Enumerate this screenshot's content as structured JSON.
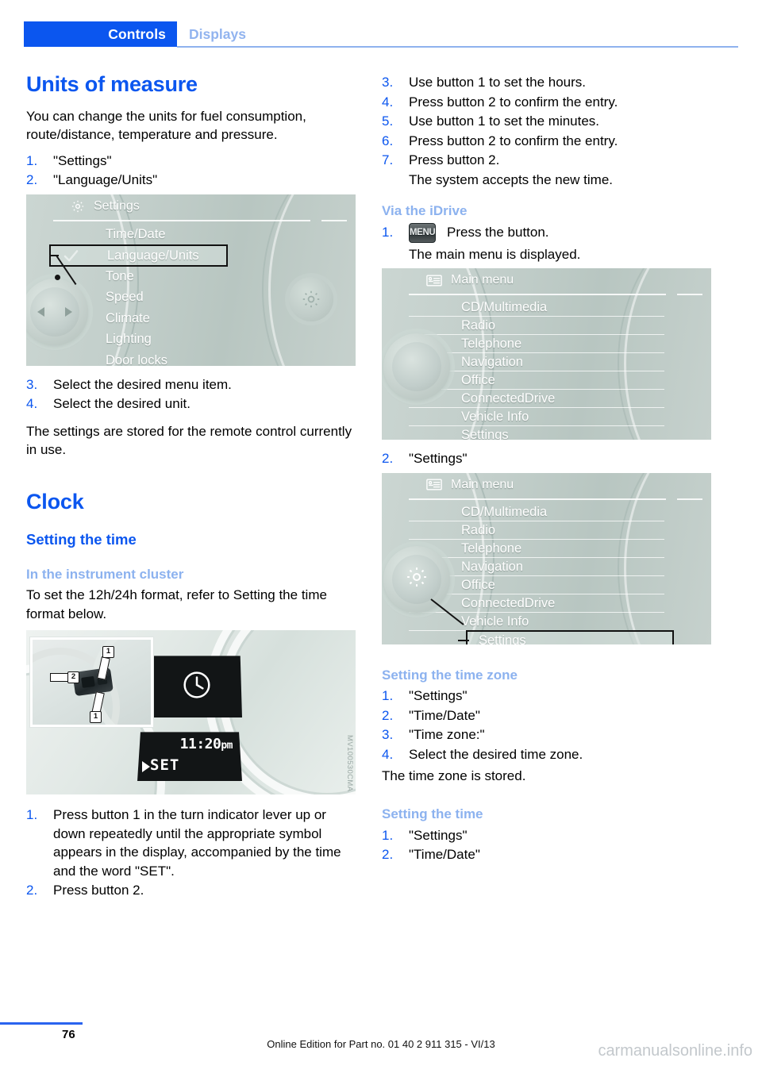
{
  "header": {
    "tab_active": "Controls",
    "tab_inactive": "Displays"
  },
  "left_column": {
    "chapter_title": "Units of measure",
    "intro": "You can change the units for fuel consumption, route/distance, temperature and pressure.",
    "steps_a": [
      {
        "num": "1.",
        "text": "\"Settings\""
      },
      {
        "num": "2.",
        "text": "\"Language/Units\""
      }
    ],
    "settings_screen": {
      "icon": "gear-icon",
      "title": "Settings",
      "items": [
        "Time/Date",
        "Language/Units",
        "Tone",
        "Speed",
        "Climate",
        "Lighting",
        "Door locks"
      ],
      "highlighted_item": "Language/Units",
      "checkmark": "✓",
      "knob_icon": "left-right-arrows-icon",
      "side_icon": "gear-icon"
    },
    "steps_b": [
      {
        "num": "3.",
        "text": "Select the desired menu item."
      },
      {
        "num": "4.",
        "text": "Select the desired unit."
      }
    ],
    "note": "The settings are stored for the remote control currently in use.",
    "clock_title": "Clock",
    "setting_time_heading": "Setting the time",
    "instrument_cluster_heading": "In the instrument cluster",
    "instrument_cluster_body": "To set the 12h/24h format, refer to Setting the time format below.",
    "cluster_image": {
      "clock_icon": "clock-icon",
      "time": "11:20",
      "ampm": "pm",
      "set_label": "SET",
      "caret": "play-caret-icon",
      "callout_1a": "1",
      "callout_1b": "1",
      "callout_2": "2",
      "watermark": "MV100530CMA"
    },
    "steps_c": [
      {
        "num": "1.",
        "text": "Press button 1 in the turn indicator lever up or down repeatedly until the appropriate symbol appears in the display, accompanied by the time and the word \"SET\"."
      },
      {
        "num": "2.",
        "text": "Press button 2."
      }
    ]
  },
  "right_column": {
    "steps_d": [
      {
        "num": "3.",
        "text": "Use button 1 to set the hours."
      },
      {
        "num": "4.",
        "text": "Press button 2 to confirm the entry."
      },
      {
        "num": "5.",
        "text": "Use button 1 to set the minutes."
      },
      {
        "num": "6.",
        "text": "Press button 2 to confirm the entry."
      },
      {
        "num": "7.",
        "text": "Press button 2."
      }
    ],
    "steps_d_note": "The system accepts the new time.",
    "via_idrive_heading": "Via the iDrive",
    "menu_step": {
      "num": "1.",
      "button_label": "MENU",
      "text": "Press the button."
    },
    "menu_step_note": "The main menu is displayed.",
    "main_menu_screen": {
      "icon": "list-menu-icon",
      "title": "Main menu",
      "items": [
        "CD/Multimedia",
        "Radio",
        "Telephone",
        "Navigation",
        "Office",
        "ConnectedDrive",
        "Vehicle Info",
        "Settings"
      ],
      "knob_icon": "plain-knob-icon"
    },
    "step_settings": {
      "num": "2.",
      "text": "\"Settings\""
    },
    "main_menu_screen_2": {
      "icon": "list-menu-icon",
      "title": "Main menu",
      "items": [
        "CD/Multimedia",
        "Radio",
        "Telephone",
        "Navigation",
        "Office",
        "ConnectedDrive",
        "Vehicle Info",
        "Settings"
      ],
      "highlighted_item": "Settings",
      "knob_icon": "gear-icon"
    },
    "time_zone_heading": "Setting the time zone",
    "steps_e": [
      {
        "num": "1.",
        "text": "\"Settings\""
      },
      {
        "num": "2.",
        "text": "\"Time/Date\""
      },
      {
        "num": "3.",
        "text": "\"Time zone:\""
      },
      {
        "num": "4.",
        "text": "Select the desired time zone."
      }
    ],
    "time_zone_note": "The time zone is stored.",
    "setting_time_heading_2": "Setting the time",
    "steps_f": [
      {
        "num": "1.",
        "text": "\"Settings\""
      },
      {
        "num": "2.",
        "text": "\"Time/Date\""
      }
    ]
  },
  "footer": {
    "page_number": "76",
    "edition": "Online Edition for Part no. 01 40 2 911 315 - VI/13",
    "watermark": "carmanualsonline.info"
  },
  "colors": {
    "accent_blue": "#0b56ef",
    "light_blue": "#8cb2ef",
    "screen_green": "#bfcbc7"
  }
}
